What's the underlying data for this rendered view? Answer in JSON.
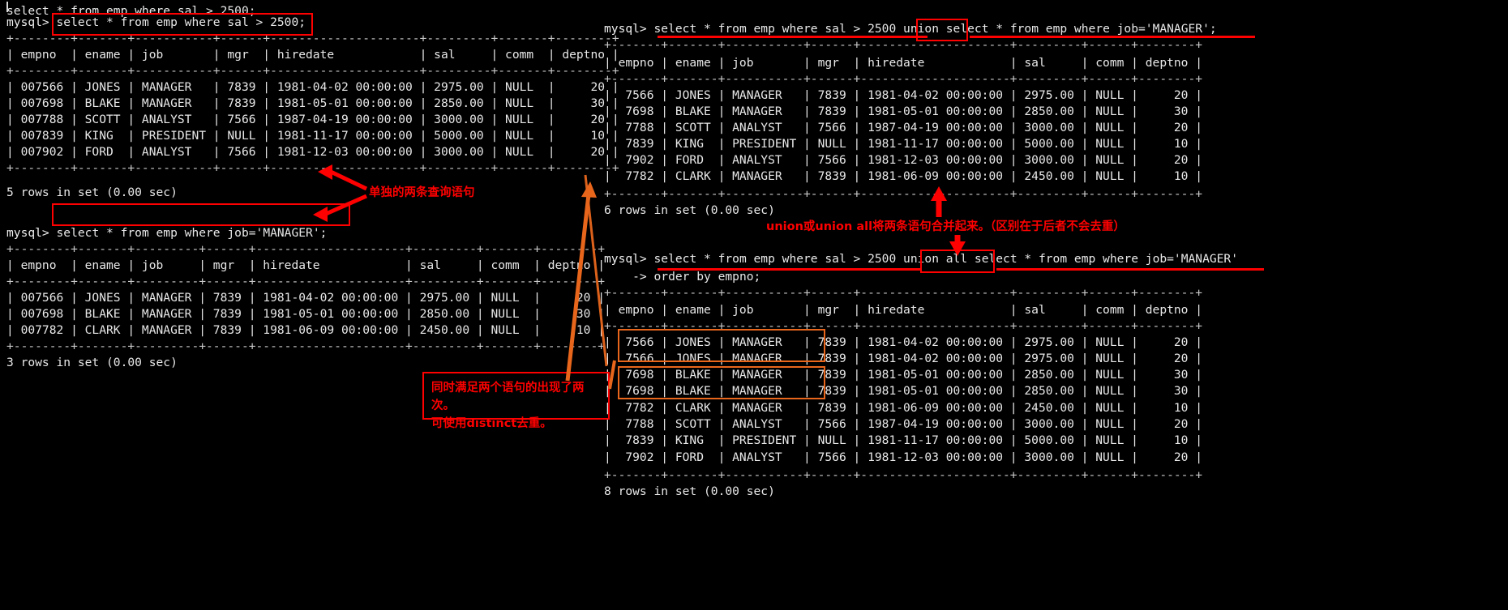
{
  "terminal": {
    "prompt": "mysql>",
    "continuation": "    ->",
    "shell": "mysql-cli",
    "bg_color": "#000000",
    "fg_color": "#e8e8e8",
    "annotation_color": "#fe0000",
    "highlight_color": "#e8661c"
  },
  "left_pane": {
    "blocks": [
      {
        "name": "query-sal-gt-2500",
        "command": "select * from emp where sal > 2500;",
        "boxed_command": true,
        "table": {
          "border": "+--------+-------+-----------+------+---------------------+---------+-------+--------+",
          "headers": [
            "empno",
            "ename",
            "job",
            "mgr",
            "hiredate",
            "sal",
            "comm",
            "deptno"
          ],
          "header_row": "| empno  | ename | job       | mgr  | hiredate            | sal     | comm  | deptno |",
          "rows": [
            "| 007566 | JONES | MANAGER   | 7839 | 1981-04-02 00:00:00 | 2975.00 | NULL  |     20 |",
            "| 007698 | BLAKE | MANAGER   | 7839 | 1981-05-01 00:00:00 | 2850.00 | NULL  |     30 |",
            "| 007788 | SCOTT | ANALYST   | 7566 | 1987-04-19 00:00:00 | 3000.00 | NULL  |     20 |",
            "| 007839 | KING  | PRESIDENT | NULL | 1981-11-17 00:00:00 | 5000.00 | NULL  |     10 |",
            "| 007902 | FORD  | ANALYST   | 7566 | 1981-12-03 00:00:00 | 3000.00 | NULL  |     20 |"
          ],
          "data": [
            {
              "empno": "007566",
              "ename": "JONES",
              "job": "MANAGER",
              "mgr": "7839",
              "hiredate": "1981-04-02 00:00:00",
              "sal": "2975.00",
              "comm": "NULL",
              "deptno": "20"
            },
            {
              "empno": "007698",
              "ename": "BLAKE",
              "job": "MANAGER",
              "mgr": "7839",
              "hiredate": "1981-05-01 00:00:00",
              "sal": "2850.00",
              "comm": "NULL",
              "deptno": "30"
            },
            {
              "empno": "007788",
              "ename": "SCOTT",
              "job": "ANALYST",
              "mgr": "7566",
              "hiredate": "1987-04-19 00:00:00",
              "sal": "3000.00",
              "comm": "NULL",
              "deptno": "20"
            },
            {
              "empno": "007839",
              "ename": "KING",
              "job": "PRESIDENT",
              "mgr": "NULL",
              "hiredate": "1981-11-17 00:00:00",
              "sal": "5000.00",
              "comm": "NULL",
              "deptno": "10"
            },
            {
              "empno": "007902",
              "ename": "FORD",
              "job": "ANALYST",
              "mgr": "7566",
              "hiredate": "1981-12-03 00:00:00",
              "sal": "3000.00",
              "comm": "NULL",
              "deptno": "20"
            }
          ]
        },
        "result": "5 rows in set (0.00 sec)"
      },
      {
        "name": "query-job-manager",
        "command": "select * from emp where job='MANAGER';",
        "boxed_command": true,
        "table": {
          "border": "+--------+-------+---------+------+---------------------+---------+-------+--------+",
          "headers": [
            "empno",
            "ename",
            "job",
            "mgr",
            "hiredate",
            "sal",
            "comm",
            "deptno"
          ],
          "header_row": "| empno  | ename | job     | mgr  | hiredate            | sal     | comm  | deptno |",
          "rows": [
            "| 007566 | JONES | MANAGER | 7839 | 1981-04-02 00:00:00 | 2975.00 | NULL  |     20 |",
            "| 007698 | BLAKE | MANAGER | 7839 | 1981-05-01 00:00:00 | 2850.00 | NULL  |     30 |",
            "| 007782 | CLARK | MANAGER | 7839 | 1981-06-09 00:00:00 | 2450.00 | NULL  |     10 |"
          ],
          "data": [
            {
              "empno": "007566",
              "ename": "JONES",
              "job": "MANAGER",
              "mgr": "7839",
              "hiredate": "1981-04-02 00:00:00",
              "sal": "2975.00",
              "comm": "NULL",
              "deptno": "20"
            },
            {
              "empno": "007698",
              "ename": "BLAKE",
              "job": "MANAGER",
              "mgr": "7839",
              "hiredate": "1981-05-01 00:00:00",
              "sal": "2850.00",
              "comm": "NULL",
              "deptno": "30"
            },
            {
              "empno": "007782",
              "ename": "CLARK",
              "job": "MANAGER",
              "mgr": "7839",
              "hiredate": "1981-06-09 00:00:00",
              "sal": "2450.00",
              "comm": "NULL",
              "deptno": "10"
            }
          ]
        },
        "result": "3 rows in set (0.00 sec)"
      }
    ]
  },
  "right_pane": {
    "blocks": [
      {
        "name": "query-union",
        "command_parts": {
          "before": "select * from emp where sal > 2500 ",
          "keyword": "union",
          "after": " select * from emp where job='MANAGER';"
        },
        "command": "select * from emp where sal > 2500 union select * from emp where job='MANAGER';",
        "table": {
          "border": "+-------+-------+-----------+------+---------------------+---------+------+--------+",
          "headers": [
            "empno",
            "ename",
            "job",
            "mgr",
            "hiredate",
            "sal",
            "comm",
            "deptno"
          ],
          "header_row": "| empno | ename | job       | mgr  | hiredate            | sal     | comm | deptno |",
          "rows": [
            "|  7566 | JONES | MANAGER   | 7839 | 1981-04-02 00:00:00 | 2975.00 | NULL |     20 |",
            "|  7698 | BLAKE | MANAGER   | 7839 | 1981-05-01 00:00:00 | 2850.00 | NULL |     30 |",
            "|  7788 | SCOTT | ANALYST   | 7566 | 1987-04-19 00:00:00 | 3000.00 | NULL |     20 |",
            "|  7839 | KING  | PRESIDENT | NULL | 1981-11-17 00:00:00 | 5000.00 | NULL |     10 |",
            "|  7902 | FORD  | ANALYST   | 7566 | 1981-12-03 00:00:00 | 3000.00 | NULL |     20 |",
            "|  7782 | CLARK | MANAGER   | 7839 | 1981-06-09 00:00:00 | 2450.00 | NULL |     10 |"
          ],
          "data": [
            {
              "empno": "7566",
              "ename": "JONES",
              "job": "MANAGER",
              "mgr": "7839",
              "hiredate": "1981-04-02 00:00:00",
              "sal": "2975.00",
              "comm": "NULL",
              "deptno": "20"
            },
            {
              "empno": "7698",
              "ename": "BLAKE",
              "job": "MANAGER",
              "mgr": "7839",
              "hiredate": "1981-05-01 00:00:00",
              "sal": "2850.00",
              "comm": "NULL",
              "deptno": "30"
            },
            {
              "empno": "7788",
              "ename": "SCOTT",
              "job": "ANALYST",
              "mgr": "7566",
              "hiredate": "1987-04-19 00:00:00",
              "sal": "3000.00",
              "comm": "NULL",
              "deptno": "20"
            },
            {
              "empno": "7839",
              "ename": "KING",
              "job": "PRESIDENT",
              "mgr": "NULL",
              "hiredate": "1981-11-17 00:00:00",
              "sal": "5000.00",
              "comm": "NULL",
              "deptno": "10"
            },
            {
              "empno": "7902",
              "ename": "FORD",
              "job": "ANALYST",
              "mgr": "7566",
              "hiredate": "1981-12-03 00:00:00",
              "sal": "3000.00",
              "comm": "NULL",
              "deptno": "20"
            },
            {
              "empno": "7782",
              "ename": "CLARK",
              "job": "MANAGER",
              "mgr": "7839",
              "hiredate": "1981-06-09 00:00:00",
              "sal": "2450.00",
              "comm": "NULL",
              "deptno": "10"
            }
          ]
        },
        "result": "6 rows in set (0.00 sec)"
      },
      {
        "name": "query-union-all",
        "command_parts": {
          "before": "select * from emp where sal > 2500 ",
          "keyword": "union all",
          "after": " select * from emp where job='MANAGER'"
        },
        "command": "select * from emp where sal > 2500 union all select * from emp where job='MANAGER'",
        "continuation_line": "order by empno;",
        "table": {
          "border": "+-------+-------+-----------+------+---------------------+---------+------+--------+",
          "headers": [
            "empno",
            "ename",
            "job",
            "mgr",
            "hiredate",
            "sal",
            "comm",
            "deptno"
          ],
          "header_row": "| empno | ename | job       | mgr  | hiredate            | sal     | comm | deptno |",
          "rows": [
            "|  7566 | JONES | MANAGER   | 7839 | 1981-04-02 00:00:00 | 2975.00 | NULL |     20 |",
            "|  7566 | JONES | MANAGER   | 7839 | 1981-04-02 00:00:00 | 2975.00 | NULL |     20 |",
            "|  7698 | BLAKE | MANAGER   | 7839 | 1981-05-01 00:00:00 | 2850.00 | NULL |     30 |",
            "|  7698 | BLAKE | MANAGER   | 7839 | 1981-05-01 00:00:00 | 2850.00 | NULL |     30 |",
            "|  7782 | CLARK | MANAGER   | 7839 | 1981-06-09 00:00:00 | 2450.00 | NULL |     10 |",
            "|  7788 | SCOTT | ANALYST   | 7566 | 1987-04-19 00:00:00 | 3000.00 | NULL |     20 |",
            "|  7839 | KING  | PRESIDENT | NULL | 1981-11-17 00:00:00 | 5000.00 | NULL |     10 |",
            "|  7902 | FORD  | ANALYST   | 7566 | 1981-12-03 00:00:00 | 3000.00 | NULL |     20 |"
          ],
          "data": [
            {
              "empno": "7566",
              "ename": "JONES",
              "job": "MANAGER",
              "mgr": "7839",
              "hiredate": "1981-04-02 00:00:00",
              "sal": "2975.00",
              "comm": "NULL",
              "deptno": "20"
            },
            {
              "empno": "7566",
              "ename": "JONES",
              "job": "MANAGER",
              "mgr": "7839",
              "hiredate": "1981-04-02 00:00:00",
              "sal": "2975.00",
              "comm": "NULL",
              "deptno": "20"
            },
            {
              "empno": "7698",
              "ename": "BLAKE",
              "job": "MANAGER",
              "mgr": "7839",
              "hiredate": "1981-05-01 00:00:00",
              "sal": "2850.00",
              "comm": "NULL",
              "deptno": "30"
            },
            {
              "empno": "7698",
              "ename": "BLAKE",
              "job": "MANAGER",
              "mgr": "7839",
              "hiredate": "1981-05-01 00:00:00",
              "sal": "2850.00",
              "comm": "NULL",
              "deptno": "30"
            },
            {
              "empno": "7782",
              "ename": "CLARK",
              "job": "MANAGER",
              "mgr": "7839",
              "hiredate": "1981-06-09 00:00:00",
              "sal": "2450.00",
              "comm": "NULL",
              "deptno": "10"
            },
            {
              "empno": "7788",
              "ename": "SCOTT",
              "job": "ANALYST",
              "mgr": "7566",
              "hiredate": "1987-04-19 00:00:00",
              "sal": "3000.00",
              "comm": "NULL",
              "deptno": "20"
            },
            {
              "empno": "7839",
              "ename": "KING",
              "job": "PRESIDENT",
              "mgr": "NULL",
              "hiredate": "1981-11-17 00:00:00",
              "sal": "5000.00",
              "comm": "NULL",
              "deptno": "10"
            },
            {
              "empno": "7902",
              "ename": "FORD",
              "job": "ANALYST",
              "mgr": "7566",
              "hiredate": "1981-12-03 00:00:00",
              "sal": "3000.00",
              "comm": "NULL",
              "deptno": "20"
            }
          ]
        },
        "result": "8 rows in set (0.00 sec)"
      }
    ]
  },
  "annotations": {
    "two_separate_queries": "单独的两条查询语句",
    "union_merges": "union或union all将两条语句合并起来。（区别在于后者不会去重）",
    "duplicates_box": "同时满足两个语句的出现了两次。\n可使用distinct去重。"
  }
}
